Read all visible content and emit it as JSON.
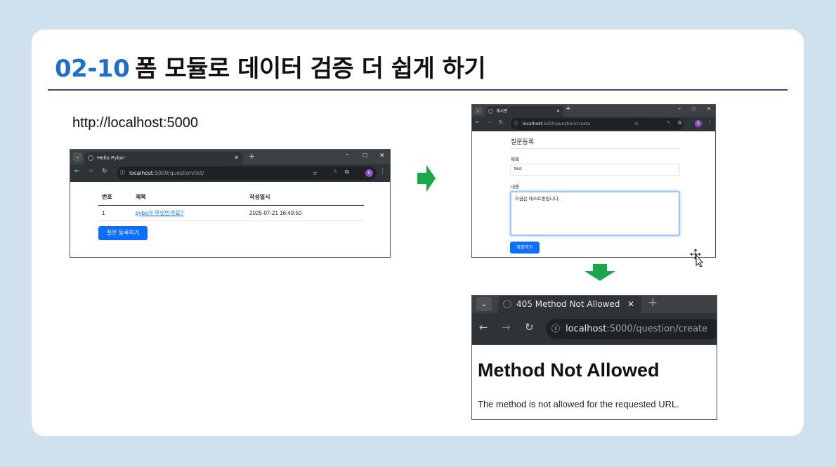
{
  "slide": {
    "number": "02-10",
    "title": "폼 모듈로 데이터 검증 더 쉽게 하기",
    "url_caption": "http://localhost:5000"
  },
  "colors": {
    "accent_blue": "#1f6fc6",
    "arrow_green": "#1aa84a",
    "bootstrap_primary": "#0d6efd",
    "background": "#cfe0ef"
  },
  "browser_list": {
    "tab_title": "Hello Pybo!",
    "omnibox_host": "localhost",
    "omnibox_path": ":5000/question/list/",
    "profile_initial": "S",
    "table": {
      "headers": [
        "번호",
        "제목",
        "작성일시"
      ],
      "rows": [
        {
          "num": "1",
          "subject": "pybo가 무엇인가요?",
          "date": "2025-07-21 16:49:50"
        }
      ]
    },
    "create_button_label": "질문 등록하기"
  },
  "browser_form": {
    "tab_title": "게시판",
    "omnibox_host": "localhost",
    "omnibox_path": ":5000/question/create",
    "profile_initial": "S",
    "heading": "질문등록",
    "subject_label": "제목",
    "subject_value": "test",
    "content_label": "내용",
    "content_value": "지금은 테스트중입니다.",
    "save_button_label": "저장하기"
  },
  "browser_error": {
    "tab_title": "405 Method Not Allowed",
    "omnibox_host": "localhost",
    "omnibox_path": ":5000/question/create",
    "error_title": "Method Not Allowed",
    "error_message": "The method is not allowed for the requested URL."
  },
  "icons": {
    "tab_menu": "chevron-down-icon",
    "new_tab": "plus-icon",
    "back": "back-arrow-icon",
    "forward": "forward-arrow-icon",
    "reload": "reload-icon",
    "site_info": "info-icon",
    "bookmark": "star-icon",
    "extensions": "puzzle-icon",
    "menu": "kebab-menu-icon",
    "close_tab": "close-icon",
    "minimize": "minimize-icon",
    "maximize": "maximize-icon",
    "close_window": "close-window-icon",
    "flow_right": "arrow-right-icon",
    "flow_down": "arrow-down-icon",
    "cursor": "move-cursor-icon"
  }
}
